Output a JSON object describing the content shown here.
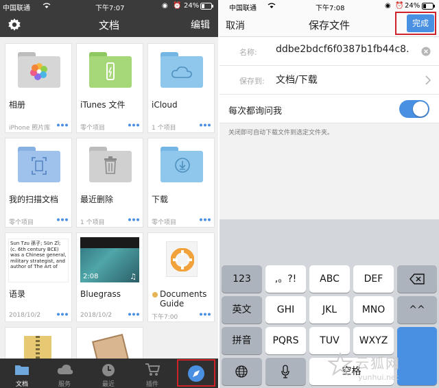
{
  "left": {
    "status": {
      "carrier": "中国联通",
      "time": "下午7:07",
      "battery": "24%"
    },
    "nav": {
      "title": "文档",
      "edit": "编辑"
    },
    "cells": [
      {
        "name": "相册",
        "sub": "iPhone 照片库",
        "type": "folder",
        "color": "#cfcfcf",
        "icon": "photos-icon"
      },
      {
        "name": "iTunes 文件",
        "sub": "零个项目",
        "type": "folder",
        "color": "#a6d87a",
        "icon": "usb-icon"
      },
      {
        "name": "iCloud",
        "sub": "1 个项目",
        "type": "folder",
        "color": "#8fc7ec",
        "icon": "cloud-icon"
      },
      {
        "name": "我的扫描文档",
        "sub": "零个项目",
        "type": "folder",
        "color": "#9ec2ec",
        "icon": "scan-icon"
      },
      {
        "name": "最近删除",
        "sub": "1 个项目",
        "type": "folder",
        "color": "#d0d0d0",
        "icon": "trash-icon"
      },
      {
        "name": "下载",
        "sub": "零个项目",
        "type": "folder",
        "color": "#8fc7ec",
        "icon": "download-icon"
      },
      {
        "name": "语录",
        "sub": "2018/10/2",
        "type": "doc",
        "preview": "Sun Tzu 孫子; Sūn Zǐ; (c. 6th century BCE) was a Chinese general, military strategist, and author of The Art of"
      },
      {
        "name": "Bluegrass",
        "sub": "2018/10/2",
        "type": "video",
        "duration": "2:08"
      },
      {
        "name": "Documents Guide",
        "sub": "下午7:00",
        "type": "guide"
      }
    ],
    "tabs": [
      "文档",
      "服务",
      "最近",
      "插件"
    ]
  },
  "right": {
    "status": {
      "carrier": "中国联通",
      "time": "下午7:08",
      "battery": "24%"
    },
    "nav": {
      "cancel": "取消",
      "title": "保存文件",
      "done": "完成"
    },
    "form": {
      "name_label": "名称:",
      "name_value": "ddbe2bdcf6f0387b1fb44c8.",
      "save_to_label": "保存到:",
      "save_to_value": "文档/下载",
      "ask_label": "每次都询问我",
      "ask_on": true,
      "hint": "关闭即可自动下载文件到选定文件夹。"
    },
    "keyboard": {
      "row1": [
        "123",
        ",。?!",
        "ABC",
        "DEF"
      ],
      "row2": [
        "英文",
        "GHI",
        "JKL",
        "MNO",
        "^^"
      ],
      "row3": [
        "拼音",
        "PQRS",
        "TUV",
        "WXYZ"
      ],
      "row4": [
        "空格"
      ]
    }
  },
  "watermark": {
    "big": "云狐网",
    "small": "yunhui.net"
  },
  "colors": {
    "accent": "#4a90e2",
    "highlight": "#d0202a"
  }
}
